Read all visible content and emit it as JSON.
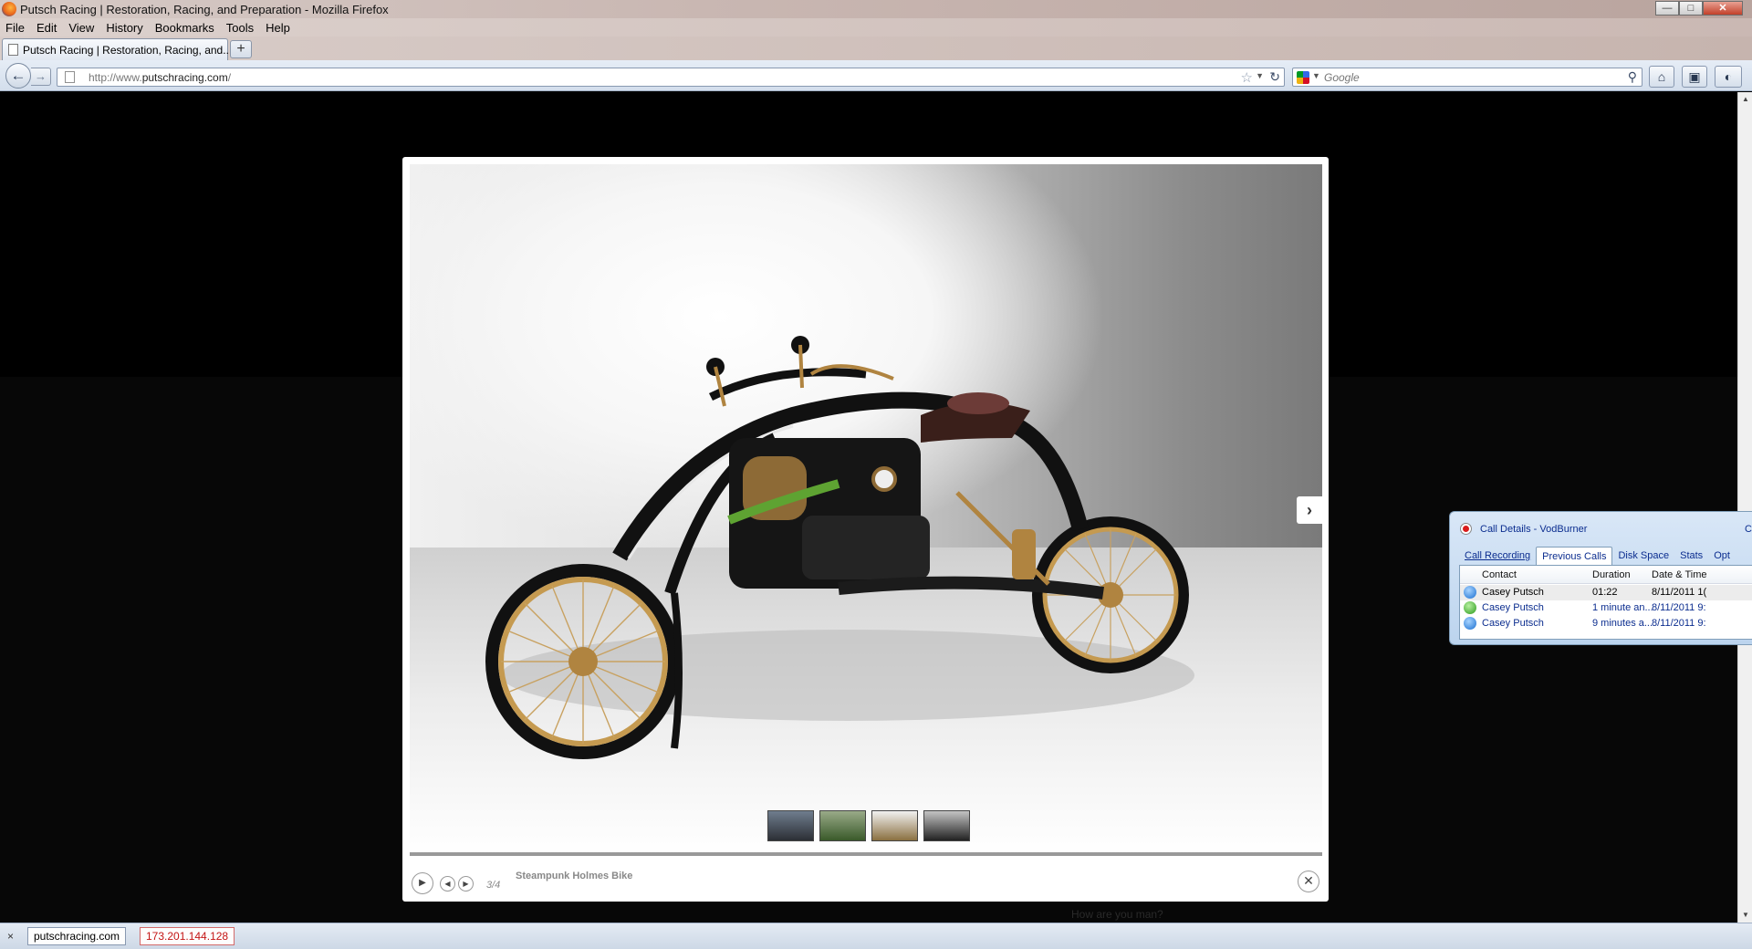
{
  "window": {
    "title": "Putsch Racing | Restoration, Racing, and Preparation - Mozilla Firefox",
    "controls": {
      "minimize": "—",
      "maximize": "□",
      "close": "✕"
    }
  },
  "menu": [
    "File",
    "Edit",
    "View",
    "History",
    "Bookmarks",
    "Tools",
    "Help"
  ],
  "tabs": [
    {
      "label": "Putsch Racing | Restoration, Racing, and...",
      "active": true
    }
  ],
  "newtab_label": "+",
  "nav": {
    "back": "←",
    "forward": "→",
    "url_prefix": "http://www.",
    "url_domain": "putschracing.com",
    "url_suffix": "/",
    "search_placeholder": "Google"
  },
  "lightbox": {
    "counter": "3/4",
    "caption": "Steampunk Holmes Bike",
    "thumbnails": 4,
    "selected_thumbnail": 3
  },
  "page_behind_text": "How are you man?",
  "vodburner": {
    "title": "Call Details - VodBurner",
    "title_overflow": "C",
    "tabs": [
      "Call Recording",
      "Previous Calls",
      "Disk Space",
      "Stats",
      "Opt"
    ],
    "active_tab": "Previous Calls",
    "columns": [
      "Contact",
      "Duration",
      "Date & Time"
    ],
    "rows": [
      {
        "contact": "Casey Putsch",
        "duration": "01:22",
        "datetime": "8/11/2011 1(",
        "icon": "call-in-icon",
        "color": "#000000"
      },
      {
        "contact": "Casey Putsch",
        "duration": "1 minute an...",
        "datetime": "8/11/2011 9:",
        "icon": "call-out-icon",
        "color": "#0b2d8f"
      },
      {
        "contact": "Casey Putsch",
        "duration": "9 minutes a...",
        "datetime": "8/11/2011 9:",
        "icon": "call-in-icon",
        "color": "#0b2d8f"
      }
    ]
  },
  "status": {
    "close": "×",
    "domain": "putschracing.com",
    "ip": "173.201.144.128"
  }
}
